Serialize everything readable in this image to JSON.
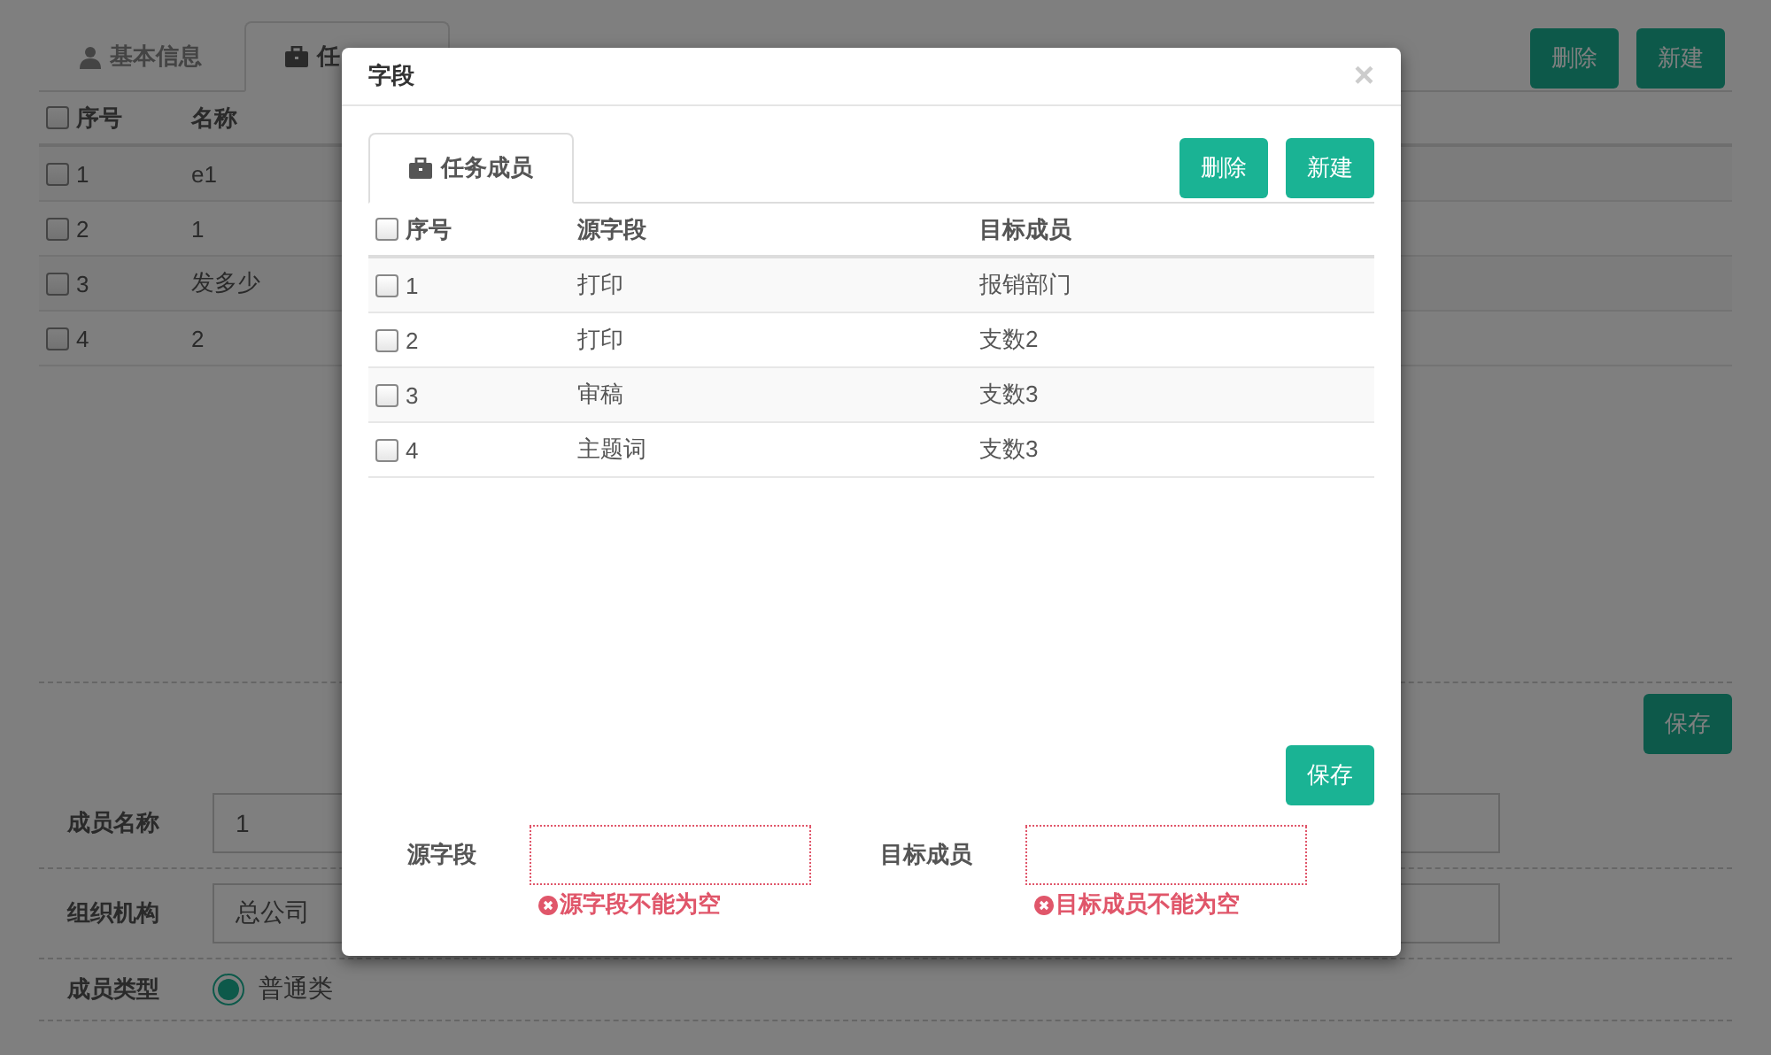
{
  "background_page": {
    "tabs": [
      {
        "label": "基本信息",
        "kind": "user",
        "selected": false
      },
      {
        "label": "任",
        "kind": "briefcase",
        "selected": true
      }
    ],
    "buttons": [
      "删除",
      "新建"
    ],
    "table": {
      "columns": [
        "序号",
        "名称"
      ],
      "all_checked": false,
      "rows": [
        {
          "index": "1",
          "name": "e1",
          "checked": false
        },
        {
          "index": "2",
          "name": "1",
          "checked": false
        },
        {
          "index": "3",
          "name": "发多少",
          "checked": false
        },
        {
          "index": "4",
          "name": "2",
          "checked": false
        }
      ]
    },
    "save_button": "保存",
    "form": [
      {
        "label": "成员名称",
        "kind": "input",
        "value": "1"
      },
      {
        "label": "组织机构",
        "kind": "input",
        "value": "总公司"
      },
      {
        "label": "成员类型",
        "kind": "radio",
        "option": "普通类",
        "selected": true
      }
    ]
  },
  "dialog": {
    "title": "字段",
    "close": "×",
    "tabs": [
      {
        "label": "任务成员",
        "kind": "briefcase",
        "selected": true
      }
    ],
    "buttons": [
      "删除",
      "新建"
    ],
    "table": {
      "columns": [
        "序号",
        "源字段",
        "目标成员"
      ],
      "all_checked": false,
      "rows": [
        {
          "index": "1",
          "source": "打印",
          "target": "报销部门",
          "checked": false
        },
        {
          "index": "2",
          "source": "打印",
          "target": "支数2",
          "checked": false
        },
        {
          "index": "3",
          "source": "审稿",
          "target": "支数3",
          "checked": false
        },
        {
          "index": "4",
          "source": "主题词",
          "target": "支数3",
          "checked": false
        }
      ]
    },
    "save_button": "保存",
    "fields": [
      {
        "label": "源字段",
        "error": "源字段不能为空"
      },
      {
        "label": "目标成员",
        "error": "目标成员不能为空"
      }
    ]
  }
}
